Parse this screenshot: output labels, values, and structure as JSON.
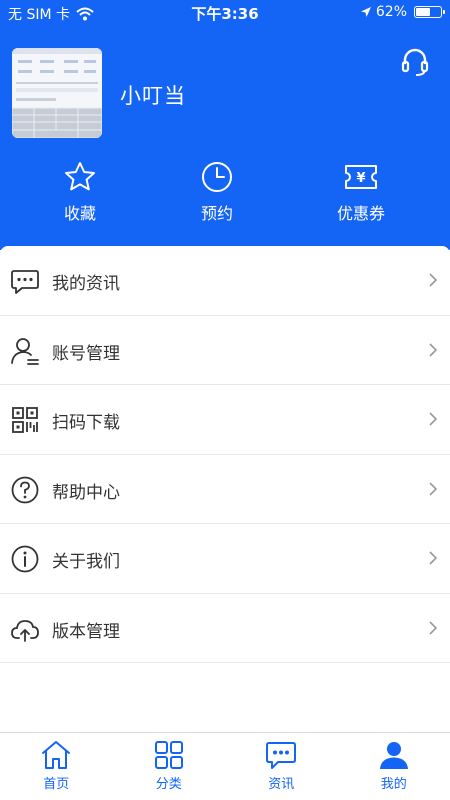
{
  "status_bar": {
    "carrier": "无 SIM 卡",
    "time": "下午3:36",
    "battery_text": "62%",
    "battery_level": 0.62
  },
  "profile": {
    "name": "小叮当"
  },
  "quick_actions": [
    {
      "label": "收藏",
      "icon": "star-icon"
    },
    {
      "label": "预约",
      "icon": "clock-icon"
    },
    {
      "label": "优惠券",
      "icon": "coupon-icon"
    }
  ],
  "menu": [
    {
      "label": "我的资讯",
      "icon": "message-icon"
    },
    {
      "label": "账号管理",
      "icon": "user-manage-icon"
    },
    {
      "label": "扫码下载",
      "icon": "qrcode-icon"
    },
    {
      "label": "帮助中心",
      "icon": "help-icon"
    },
    {
      "label": "关于我们",
      "icon": "info-icon"
    },
    {
      "label": "版本管理",
      "icon": "cloud-upload-icon"
    }
  ],
  "tabs": [
    {
      "label": "首页",
      "icon": "home-icon"
    },
    {
      "label": "分类",
      "icon": "grid-icon"
    },
    {
      "label": "资讯",
      "icon": "chat-icon"
    },
    {
      "label": "我的",
      "icon": "person-icon",
      "active": true
    }
  ],
  "colors": {
    "brand": "#1464f6",
    "text": "#333333",
    "divider": "#e6e6e6"
  }
}
